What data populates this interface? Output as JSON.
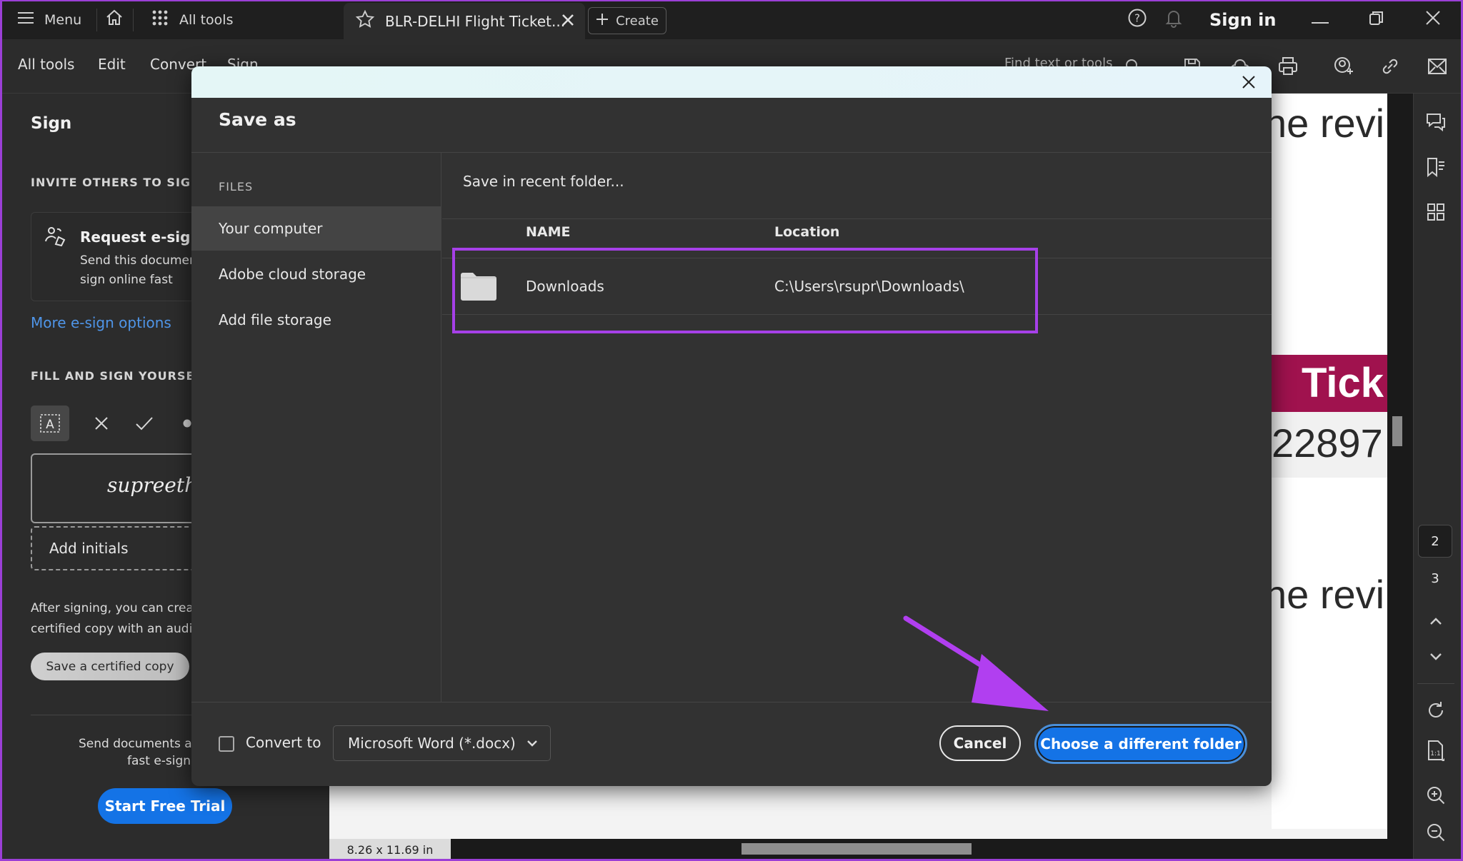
{
  "titlebar": {
    "menu_label": "Menu",
    "all_tools_label": "All tools",
    "tab_title": "BLR-DELHI Flight Ticket...",
    "create_label": "Create",
    "sign_in_label": "Sign in"
  },
  "toolbar": {
    "items": [
      "All tools",
      "Edit",
      "Convert",
      "Sign"
    ],
    "search_placeholder": "Find text or tools"
  },
  "left_panel": {
    "title": "Sign",
    "invite_heading": "INVITE OTHERS TO SIGN",
    "request_title": "Request e-signatures",
    "request_desc_line1": "Send this document",
    "request_desc_line2": "sign online fast",
    "more_link": "More e-sign options",
    "fill_heading": "FILL AND SIGN YOURSELF",
    "signature_text": "supreeth",
    "add_initials": "Add initials",
    "after_line1": "After signing, you can create a",
    "after_line2": "certified copy with an audit trail",
    "certified_button": "Save a certified copy",
    "promo_line1": "Send documents and",
    "promo_line2": "fast e-signing",
    "trial_button": "Start Free Trial"
  },
  "document": {
    "text_top": "he revi",
    "band_text": "Tick",
    "number_text": "22897",
    "text_bottom": "he revi",
    "page_size": "8.26 x 11.69 in",
    "band_color": "#a0124e"
  },
  "right_rail": {
    "pages": [
      "2",
      "3"
    ],
    "current_page": "2"
  },
  "dialog": {
    "title": "Save as",
    "nav_caption": "FILES",
    "nav_items": [
      "Your computer",
      "Adobe cloud storage",
      "Add file storage"
    ],
    "active_nav": "Your computer",
    "recent_label": "Save in recent folder...",
    "columns": [
      "NAME",
      "Location"
    ],
    "rows": [
      {
        "name": "Downloads",
        "location": "C:\\Users\\rsupr\\Downloads\\"
      }
    ],
    "convert_label": "Convert to",
    "convert_checked": false,
    "format_selected": "Microsoft Word (*.docx)",
    "cancel_label": "Cancel",
    "primary_label": "Choose a different folder"
  },
  "colors": {
    "accent_blue": "#1473e6",
    "annotation_purple": "#a640e8",
    "link_blue": "#4f95e8"
  }
}
